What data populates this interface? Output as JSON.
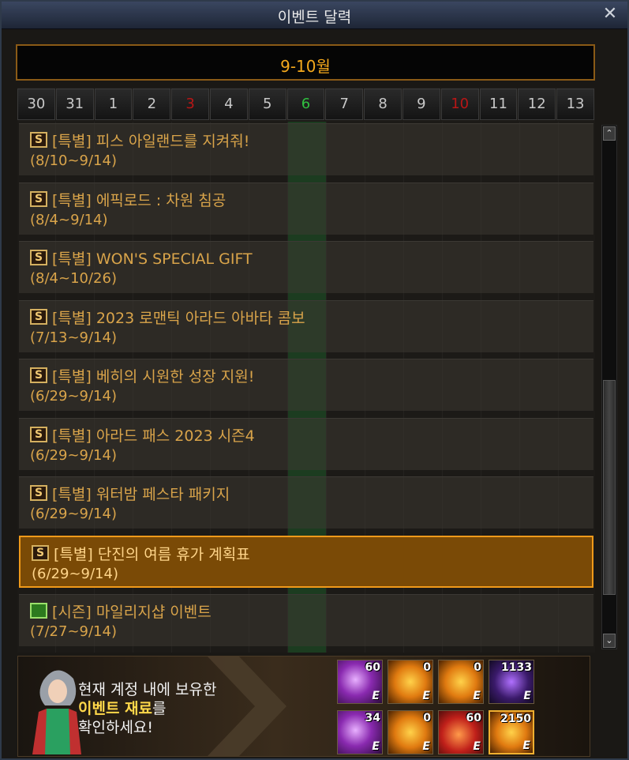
{
  "window": {
    "title": "이벤트 달력",
    "close_glyph": "✕"
  },
  "month_label": "9-10월",
  "days": [
    {
      "label": "30",
      "type": "normal"
    },
    {
      "label": "31",
      "type": "normal"
    },
    {
      "label": "1",
      "type": "normal"
    },
    {
      "label": "2",
      "type": "normal"
    },
    {
      "label": "3",
      "type": "sunday"
    },
    {
      "label": "4",
      "type": "normal"
    },
    {
      "label": "5",
      "type": "normal"
    },
    {
      "label": "6",
      "type": "today"
    },
    {
      "label": "7",
      "type": "normal"
    },
    {
      "label": "8",
      "type": "normal"
    },
    {
      "label": "9",
      "type": "normal"
    },
    {
      "label": "10",
      "type": "sunday"
    },
    {
      "label": "11",
      "type": "normal"
    },
    {
      "label": "12",
      "type": "normal"
    },
    {
      "label": "13",
      "type": "normal"
    }
  ],
  "events": [
    {
      "badge": "S",
      "kind": "special",
      "name": "[특별] 피스 아일랜드를 지켜줘!",
      "period": "(8/10~9/14)",
      "selected": false
    },
    {
      "badge": "S",
      "kind": "special",
      "name": "[특별] 에픽로드 : 차원 침공",
      "period": "(8/4~9/14)",
      "selected": false
    },
    {
      "badge": "S",
      "kind": "special",
      "name": "[특별] WON'S SPECIAL GIFT",
      "period": "(8/4~10/26)",
      "selected": false
    },
    {
      "badge": "S",
      "kind": "special",
      "name": "[특별] 2023 로맨틱 아라드 아바타 콤보",
      "period": "(7/13~9/14)",
      "selected": false
    },
    {
      "badge": "S",
      "kind": "special",
      "name": "[특별] 베히의 시원한 성장 지원!",
      "period": "(6/29~9/14)",
      "selected": false
    },
    {
      "badge": "S",
      "kind": "special",
      "name": "[특별] 아라드 패스 2023 시즌4",
      "period": "(6/29~9/14)",
      "selected": false
    },
    {
      "badge": "S",
      "kind": "special",
      "name": "[특별] 워터밤 페스타 패키지",
      "period": "(6/29~9/14)",
      "selected": false
    },
    {
      "badge": "S",
      "kind": "special",
      "name": "[특별] 단진의 여름 휴가 계획표",
      "period": "(6/29~9/14)",
      "selected": true
    },
    {
      "badge": "",
      "kind": "season",
      "name": "[시즌] 마일리지샵 이벤트",
      "period": "(7/27~9/14)",
      "selected": false
    }
  ],
  "scrollbar": {
    "up_glyph": "⌃",
    "down_glyph": "⌄"
  },
  "footer": {
    "line1": "현재 계정 내에 보유한",
    "line2_highlight": "이벤트 재료",
    "line2_rest": "를",
    "line3": "확인하세요!"
  },
  "materials": [
    {
      "count": "60",
      "style": "purple",
      "e": "E",
      "selected": false
    },
    {
      "count": "0",
      "style": "gold",
      "e": "E",
      "selected": false
    },
    {
      "count": "0",
      "style": "gold",
      "e": "E",
      "selected": false
    },
    {
      "count": "1133",
      "style": "darkp",
      "e": "E",
      "selected": false
    },
    {
      "count": "34",
      "style": "purple",
      "e": "E",
      "selected": false
    },
    {
      "count": "0",
      "style": "gold",
      "e": "E",
      "selected": false
    },
    {
      "count": "60",
      "style": "fire",
      "e": "E",
      "selected": false
    },
    {
      "count": "2150",
      "style": "gold",
      "e": "E",
      "selected": true
    }
  ],
  "colors": {
    "accent_orange": "#f4a81c",
    "event_text": "#d9a44a",
    "today_green": "#30c040",
    "sunday_red": "#b81616",
    "highlight_yellow": "#ffd84a"
  }
}
